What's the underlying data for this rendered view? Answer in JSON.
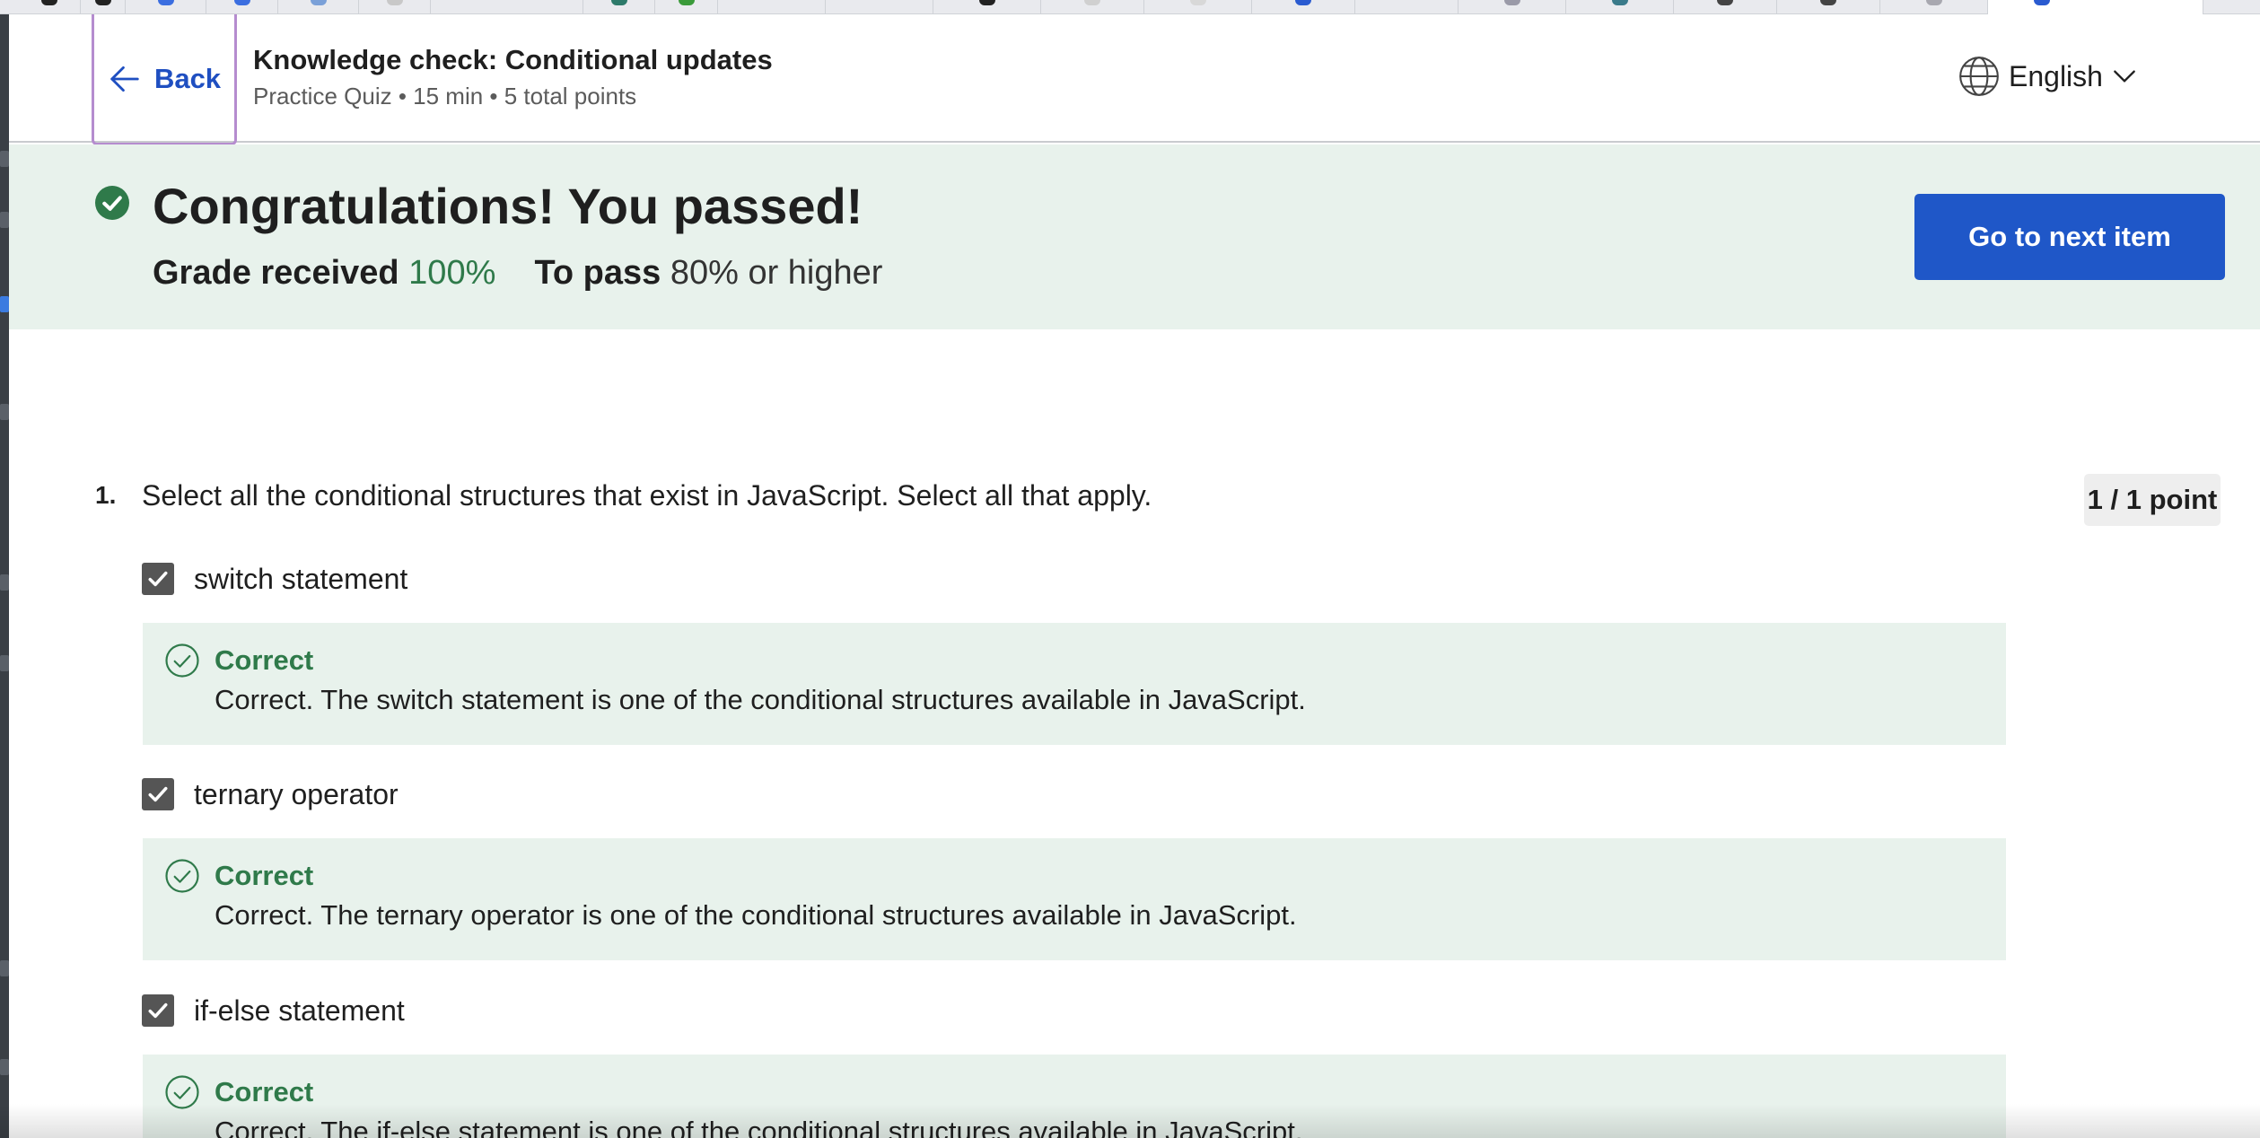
{
  "header": {
    "back_label": "Back",
    "title": "Knowledge check: Conditional updates",
    "meta": "Practice Quiz • 15 min • 5 total points",
    "language": "English"
  },
  "result": {
    "title": "Congratulations! You passed!",
    "grade_label": "Grade received",
    "grade_value": "100%",
    "pass_label": "To pass",
    "pass_value": "80% or higher",
    "next_button": "Go to next item"
  },
  "question": {
    "number": "1.",
    "text": "Select all the conditional structures that exist in JavaScript. Select all that apply.",
    "points": "1 / 1 point",
    "options": [
      {
        "label": "switch statement",
        "checked": true,
        "feedback_title": "Correct",
        "feedback_text": "Correct. The switch statement is one of the conditional structures available in JavaScript."
      },
      {
        "label": "ternary operator",
        "checked": true,
        "feedback_title": "Correct",
        "feedback_text": "Correct. The ternary operator is one of the conditional structures available in JavaScript."
      },
      {
        "label": "if-else statement",
        "checked": true,
        "feedback_title": "Correct",
        "feedback_text": "Correct. The if-else statement is one of the conditional structures available in JavaScript."
      }
    ]
  },
  "colors": {
    "accent": "#1f57c8",
    "success": "#2f7a4a",
    "success_bg": "#e8f2ec"
  }
}
